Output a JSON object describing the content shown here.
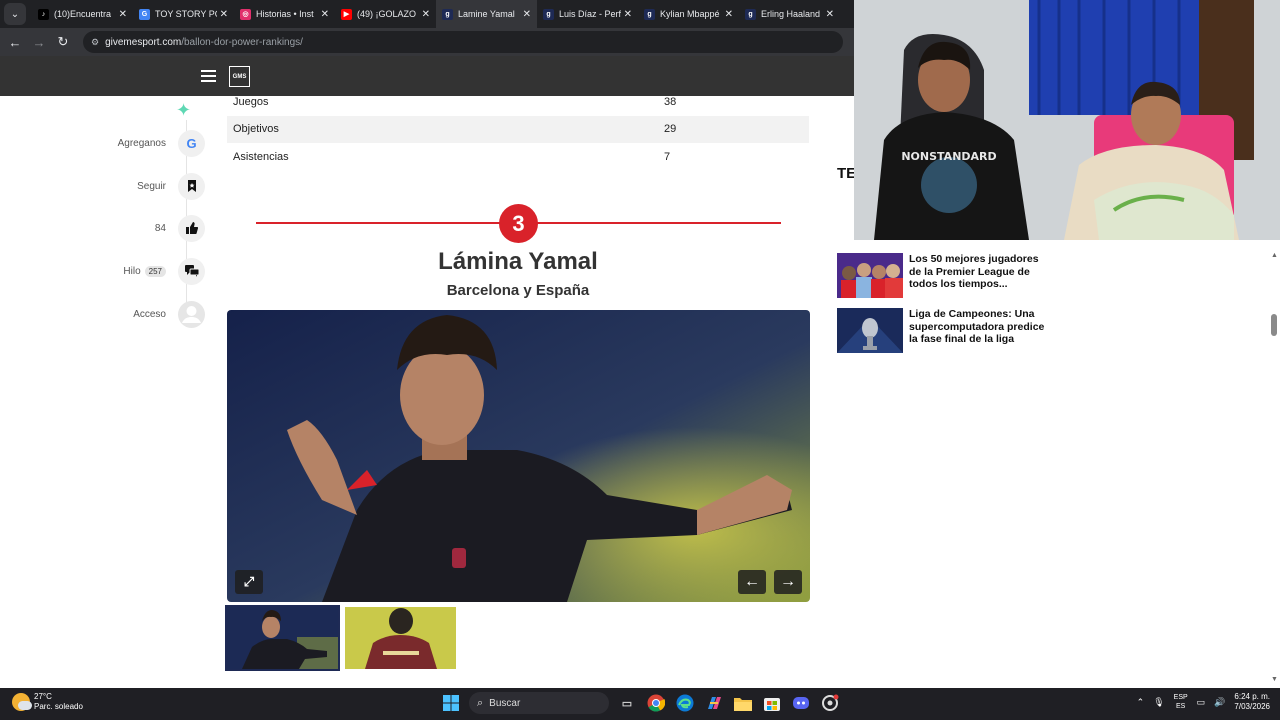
{
  "browser": {
    "tabs": [
      {
        "label": "(10)Encuentra",
        "favicon_color": "#000000"
      },
      {
        "label": "TOY STORY PO",
        "favicon_color": "#4285f4"
      },
      {
        "label": "Historias • Inst",
        "favicon_color": "#e1306c"
      },
      {
        "label": "(49) ¡GOLAZO",
        "favicon_color": "#ff0000"
      },
      {
        "label": "Lamine Yamal",
        "favicon_color": "#1e2a55"
      },
      {
        "label": "Luis Díaz - Perf",
        "favicon_color": "#1e2a55"
      },
      {
        "label": "Kylian Mbappé",
        "favicon_color": "#1e2a55"
      },
      {
        "label": "Erling Haaland",
        "favicon_color": "#1e2a55"
      }
    ],
    "url_domain": "givemesport.com",
    "url_path": "/ballon-dor-power-rankings/"
  },
  "site": {
    "logo_text": "GMS"
  },
  "rail": {
    "items": [
      {
        "label": "Agreganos",
        "icon": "google-icon",
        "glyph": "G"
      },
      {
        "label": "Seguir",
        "icon": "bookmark-icon",
        "glyph": "🔖"
      },
      {
        "label": "84",
        "icon": "thumbs-up-icon",
        "glyph": "👍"
      },
      {
        "label": "Hilo",
        "count": "257",
        "icon": "comments-icon",
        "glyph": "💬"
      },
      {
        "label": "Acceso",
        "icon": "user-icon",
        "glyph": "👤"
      }
    ]
  },
  "stats": [
    {
      "label": "Juegos",
      "value": "38"
    },
    {
      "label": "Objetivos",
      "value": "29"
    },
    {
      "label": "Asistencias",
      "value": "7"
    }
  ],
  "ranking": {
    "position": "3",
    "name": "Lámina Yamal",
    "club": "Barcelona y España"
  },
  "gallery": {
    "expand_glyph": "⤢",
    "prev_glyph": "←",
    "next_glyph": "→",
    "active_thumb": 1,
    "thumb_count": 2
  },
  "sidebar": {
    "heading": "TE",
    "related": [
      {
        "title": "Los 50 mejores jugadores de la Premier League de todos los tiempos..."
      },
      {
        "title": "Liga de Campeones: Una supercomputadora predice la fase final de la liga"
      }
    ]
  },
  "taskbar": {
    "temperature": "27°C",
    "weather": "Parc. soleado",
    "search_placeholder": "Buscar",
    "lang_top": "ESP",
    "lang_bottom": "ES",
    "time": "6:24 p. m.",
    "date": "7/03/2026"
  },
  "colors": {
    "accent_red": "#d9222a",
    "header_bg": "#333333",
    "chrome_dark": "#202124"
  }
}
